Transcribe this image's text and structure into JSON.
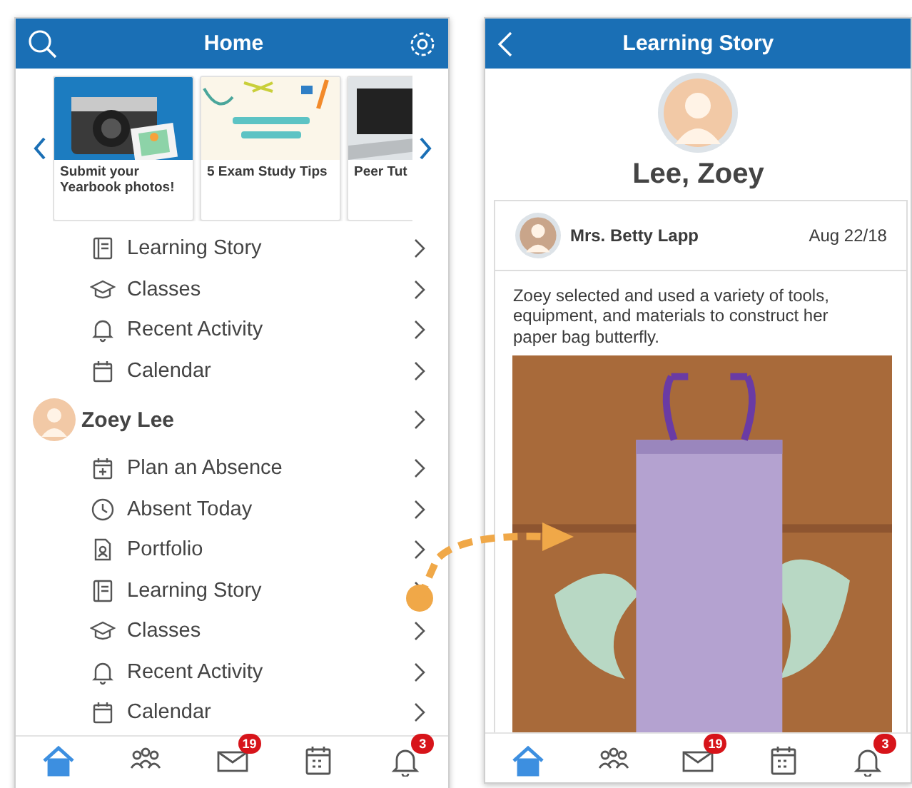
{
  "home": {
    "title": "Home",
    "carousel": [
      {
        "caption": "Submit your Yearbook photos!",
        "kind": "picture"
      },
      {
        "caption": "5 Exam Study Tips",
        "kind": "picture"
      },
      {
        "caption": "Peer Tut",
        "kind": "picture"
      }
    ],
    "menu": [
      {
        "label": "Learning Story",
        "kind": "book"
      },
      {
        "label": "Classes",
        "kind": "cap"
      },
      {
        "label": "Recent Activity",
        "kind": "bell"
      },
      {
        "label": "Calendar",
        "kind": "calendar"
      }
    ],
    "child": {
      "name": "Zoey Lee"
    },
    "child_menu": [
      {
        "label": "Plan an Absence",
        "kind": "plan"
      },
      {
        "label": "Absent Today",
        "kind": "clock"
      },
      {
        "label": "Portfolio",
        "kind": "portfolio"
      },
      {
        "label": "Learning Story",
        "kind": "book"
      },
      {
        "label": "Classes",
        "kind": "cap"
      },
      {
        "label": "Recent Activity",
        "kind": "bell"
      },
      {
        "label": "Calendar",
        "kind": "calendar"
      }
    ],
    "nav": [
      {
        "kind": "home",
        "selected": true
      },
      {
        "kind": "people",
        "selected": false
      },
      {
        "kind": "mail",
        "selected": false,
        "badge": "19"
      },
      {
        "kind": "calendar",
        "selected": false
      },
      {
        "kind": "bell",
        "selected": false,
        "badge": "3"
      }
    ]
  },
  "story": {
    "title": "Learning Story",
    "child_name": "Lee, Zoey",
    "author": "Mrs. Betty Lapp",
    "date": "Aug 22/18",
    "text": "Zoey selected and used a variety of tools, equipment, and materials to construct her paper bag butterfly.",
    "nav": [
      {
        "kind": "home",
        "selected": true
      },
      {
        "kind": "people",
        "selected": false
      },
      {
        "kind": "mail",
        "selected": false,
        "badge": "19"
      },
      {
        "kind": "calendar",
        "selected": false
      },
      {
        "kind": "bell",
        "selected": false,
        "badge": "3"
      }
    ]
  }
}
